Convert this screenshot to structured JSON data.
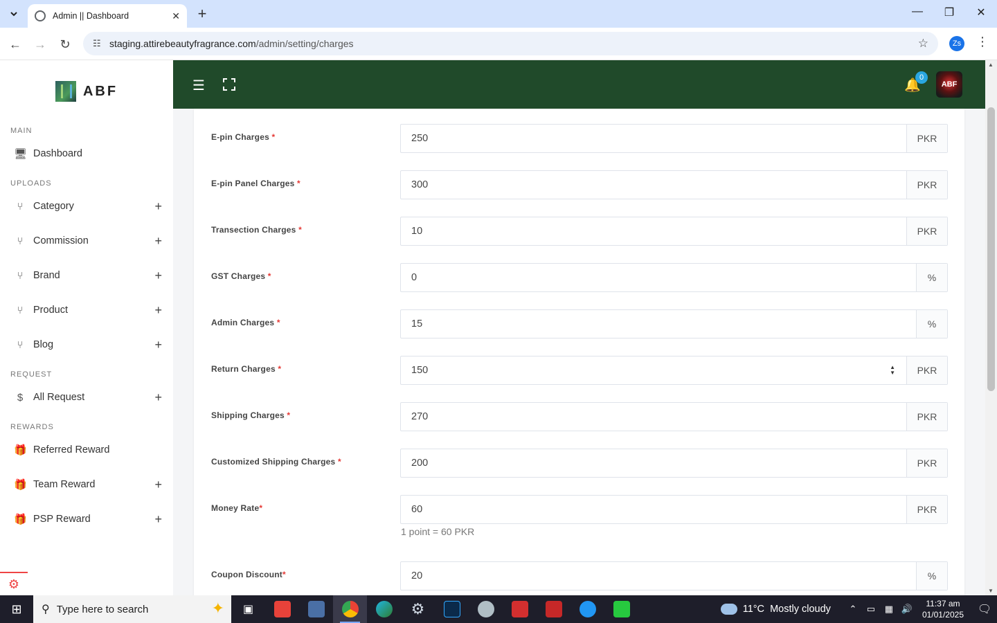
{
  "browser": {
    "tab_title": "Admin || Dashboard",
    "url_host": "staging.attirebeautyfragrance.com",
    "url_path": "/admin/setting/charges",
    "profile_initials": "Zs"
  },
  "sidebar": {
    "brand": "ABF",
    "sections": {
      "main": "MAIN",
      "uploads": "UPLOADS",
      "request": "REQUEST",
      "rewards": "REWARDS"
    },
    "items": {
      "dashboard": "Dashboard",
      "category": "Category",
      "commission": "Commission",
      "brand": "Brand",
      "product": "Product",
      "blog": "Blog",
      "all_request": "All Request",
      "referred_reward": "Referred Reward",
      "team_reward": "Team Reward",
      "psp_reward": "PSP Reward"
    },
    "plus": "+"
  },
  "topbar": {
    "notification_count": "0",
    "avatar_text": "ABF"
  },
  "form": {
    "required_mark": "*",
    "fields": [
      {
        "label": "E-pin Charges",
        "value": "250",
        "addon": "PKR"
      },
      {
        "label": "E-pin Panel Charges",
        "value": "300",
        "addon": "PKR"
      },
      {
        "label": "Transection Charges",
        "value": "10",
        "addon": "PKR"
      },
      {
        "label": "GST Charges",
        "value": "0",
        "addon": "%"
      },
      {
        "label": "Admin Charges",
        "value": "15",
        "addon": "%"
      },
      {
        "label": "Return Charges",
        "value": "150",
        "addon": "PKR"
      },
      {
        "label": "Shipping Charges",
        "value": "270",
        "addon": "PKR"
      },
      {
        "label": "Customized Shipping Charges",
        "value": "200",
        "addon": "PKR"
      },
      {
        "label": "Money Rate",
        "value": "60",
        "addon": "PKR",
        "help": "1 point = 60 PKR"
      },
      {
        "label": "Coupon Discount",
        "value": "20",
        "addon": "%"
      }
    ]
  },
  "taskbar": {
    "search_placeholder": "Type here to search",
    "weather_temp": "11°C",
    "weather_desc": "Mostly cloudy",
    "time": "11:37 am",
    "date": "01/01/2025"
  },
  "colors": {
    "topbar": "#204a2a",
    "required": "#e53935",
    "badge": "#2aa6e0"
  }
}
